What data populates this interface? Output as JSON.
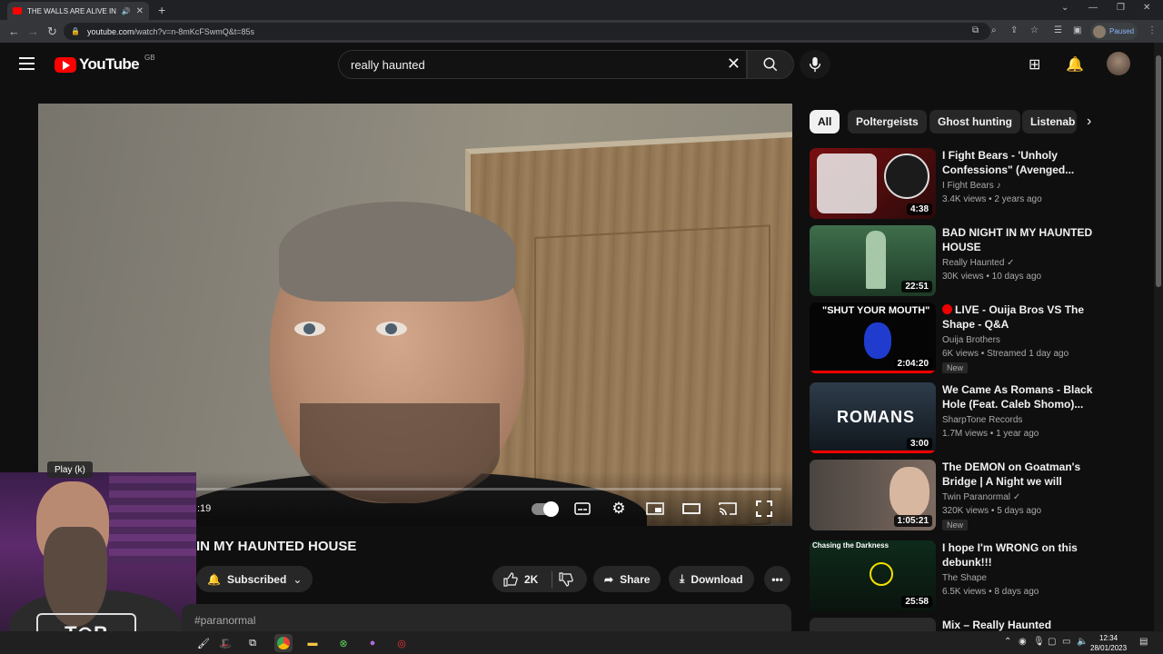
{
  "browser": {
    "tab_title": "THE WALLS ARE ALIVE IN M",
    "url_host": "youtube.com",
    "url_path": "/watch?v=n-8mKcFSwmQ&t=85s",
    "profile_status": "Paused"
  },
  "header": {
    "logo_text": "YouTube",
    "country_code": "GB",
    "search_value": "really haunted"
  },
  "player": {
    "tooltip": "Play (k)",
    "time_fragment": ":19"
  },
  "video": {
    "title": "IN MY HAUNTED HOUSE",
    "subscribe_label": "Subscribed",
    "like_count": "2K",
    "share_label": "Share",
    "download_label": "Download",
    "description_tag": "#paranormal"
  },
  "chips": [
    "All",
    "Poltergeists",
    "Ghost hunting",
    "Listenab"
  ],
  "related": [
    {
      "title": "I Fight Bears - 'Unholy Confessions\" (Avenged...",
      "channel": "I Fight Bears",
      "channel_badge": "♪",
      "meta": "3.4K views • 2 years ago",
      "duration": "4:38",
      "new": ""
    },
    {
      "title": "BAD NIGHT IN MY HAUNTED HOUSE",
      "channel": "Really Haunted",
      "channel_badge": "✓",
      "meta": "30K views • 10 days ago",
      "duration": "22:51",
      "new": ""
    },
    {
      "title": "LIVE - Ouija Bros VS The Shape - Q&A",
      "channel": "Ouija Brothers",
      "channel_badge": "",
      "meta": "6K views • Streamed 1 day ago",
      "duration": "2:04:20",
      "new": "New",
      "thumb_text": "\"SHUT YOUR MOUTH\""
    },
    {
      "title": "We Came As Romans - Black Hole (Feat. Caleb Shomo)...",
      "channel": "SharpTone Records",
      "channel_badge": "",
      "meta": "1.7M views • 1 year ago",
      "duration": "3:00",
      "new": "",
      "thumb_text": "ROMANS"
    },
    {
      "title": "The DEMON on Goatman's Bridge | A Night we will NEVER...",
      "channel": "Twin Paranormal",
      "channel_badge": "✓",
      "meta": "320K views • 5 days ago",
      "duration": "1:05:21",
      "new": "New"
    },
    {
      "title": "I hope I'm WRONG on this debunk!!!",
      "channel": "The Shape",
      "channel_badge": "",
      "meta": "6.5K views • 8 days ago",
      "duration": "25:58",
      "new": "",
      "thumb_text": "Chasing the Darkness"
    },
    {
      "title": "Mix – Really Haunted",
      "channel": "",
      "channel_badge": "",
      "meta": "",
      "duration": "",
      "new": ""
    }
  ],
  "taskbar": {
    "time": "12:34",
    "date": "28/01/2023"
  },
  "colors": {
    "yt_red": "#ff0000",
    "bg": "#0f0f0f",
    "chip": "#272727"
  }
}
